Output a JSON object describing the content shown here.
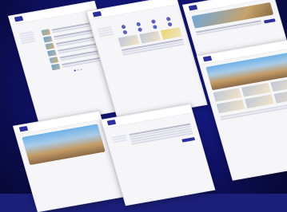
{
  "canvas": {
    "background": "#0b0f66"
  },
  "pages": [
    {
      "id": "p1",
      "header": "",
      "title": "",
      "subtitle": ""
    },
    {
      "id": "p2",
      "header": "",
      "title": "",
      "subtitle": ""
    },
    {
      "id": "p3",
      "header": "",
      "title": "",
      "subtitle": ""
    },
    {
      "id": "p4",
      "header": "",
      "title": "",
      "subtitle": ""
    },
    {
      "id": "p5",
      "header": "",
      "title": "",
      "subtitle": ""
    },
    {
      "id": "p6",
      "header": "",
      "title": "",
      "subtitle": ""
    }
  ],
  "colors": {
    "accent": "#2a2f9b",
    "page_bg": "#f6f6f8"
  }
}
